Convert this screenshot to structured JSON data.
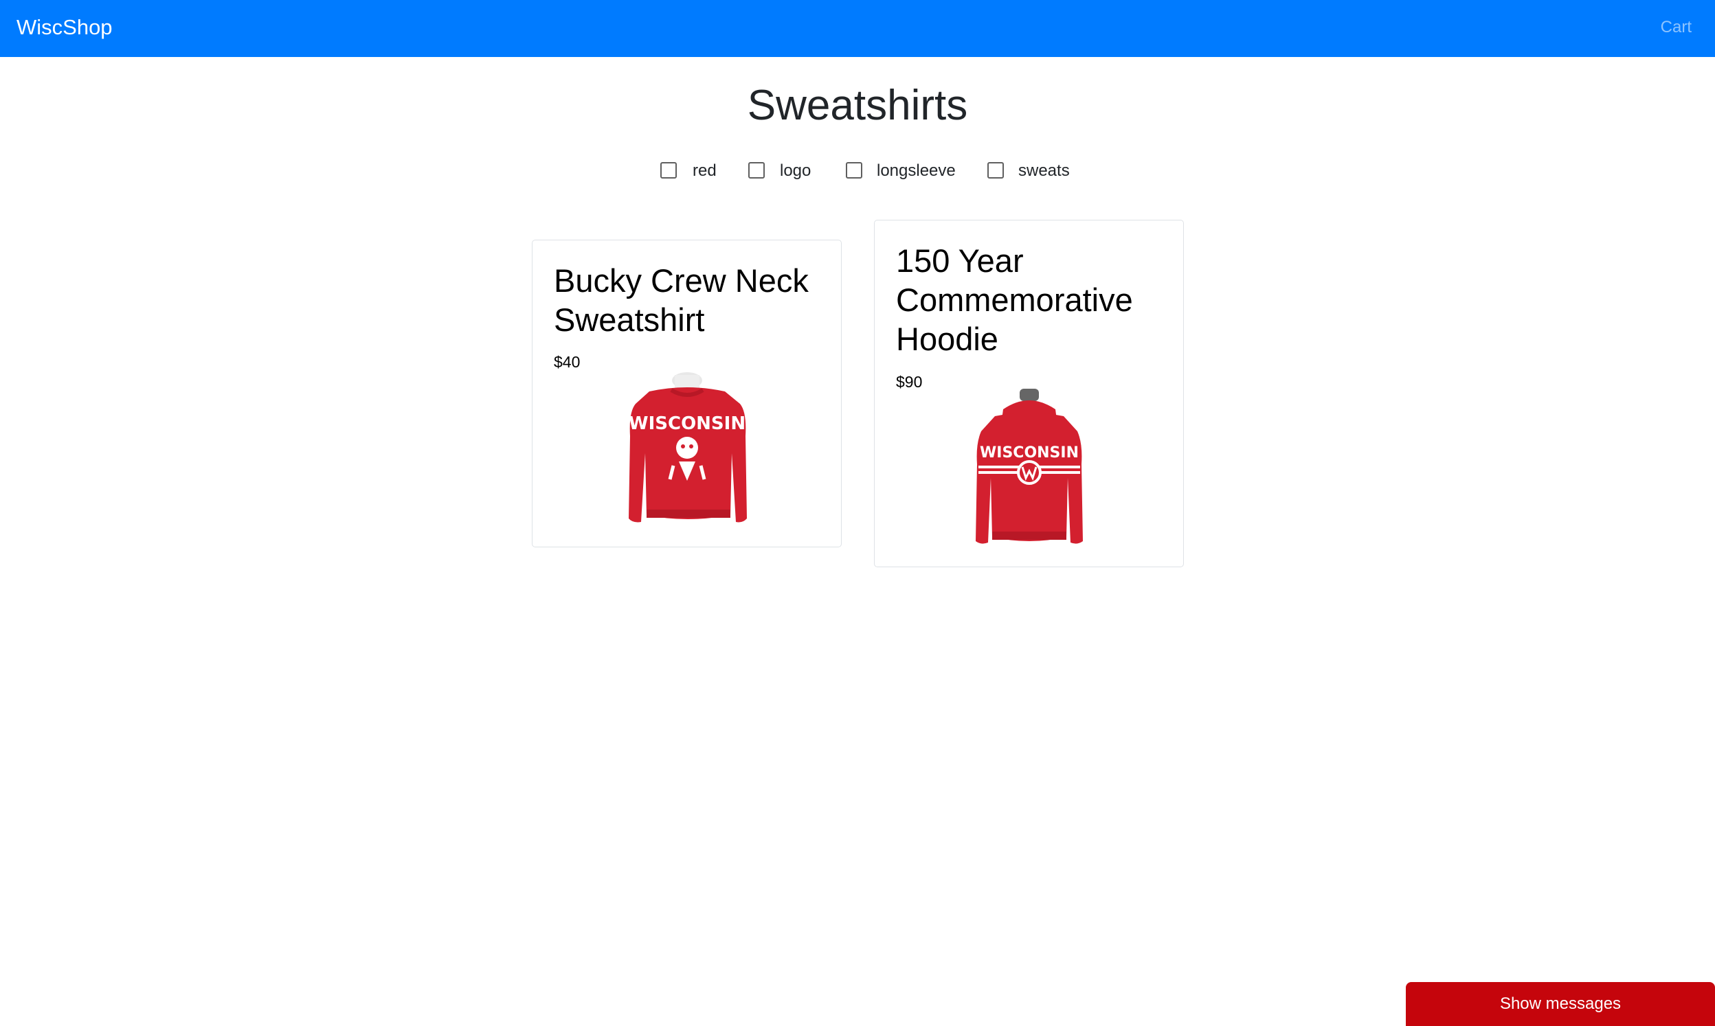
{
  "navbar": {
    "brand": "WiscShop",
    "cart_label": "Cart",
    "bg_color": "#007bff"
  },
  "page": {
    "title": "Sweatshirts"
  },
  "filters": [
    {
      "label": "red",
      "checked": false
    },
    {
      "label": "logo",
      "checked": false
    },
    {
      "label": "longsleeve",
      "checked": false
    },
    {
      "label": "sweats",
      "checked": false
    }
  ],
  "products": [
    {
      "name": "Bucky Crew Neck Sweatshirt",
      "price": "$40",
      "image": "red-crewneck-sweatshirt-wisconsin-bucky",
      "color": "#d0202f"
    },
    {
      "name": "150 Year Commemorative Hoodie",
      "price": "$90",
      "image": "red-hoodie-wisconsin-150-year",
      "color": "#d0202f"
    }
  ],
  "messages_button": {
    "label": "Show messages",
    "color": "#c5050c"
  }
}
